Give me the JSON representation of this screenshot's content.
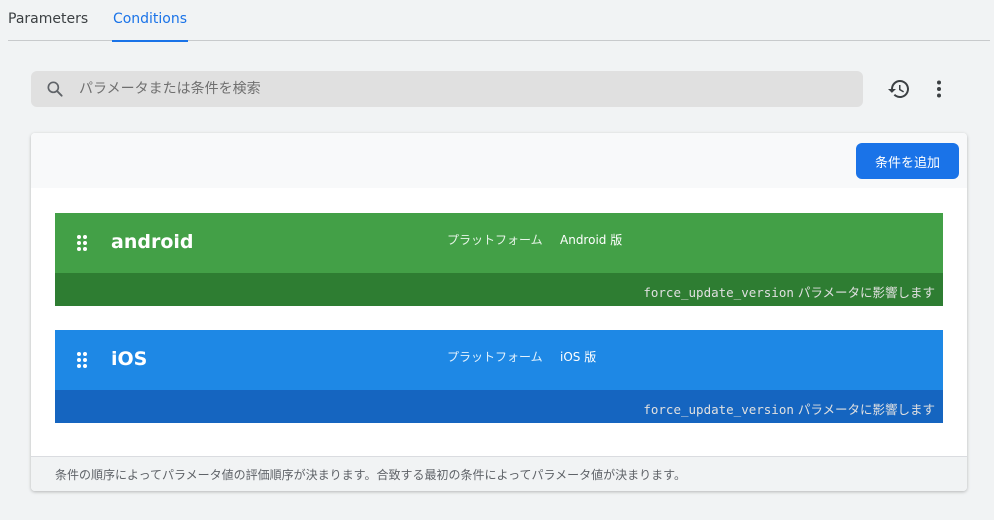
{
  "tabs": [
    {
      "label": "Parameters",
      "active": false
    },
    {
      "label": "Conditions",
      "active": true
    }
  ],
  "search": {
    "placeholder": "パラメータまたは条件を検索",
    "value": ""
  },
  "toolbar": {
    "history_icon": "history-icon",
    "more_icon": "more-vert-icon"
  },
  "conditions_card": {
    "add_button_label": "条件を追加",
    "footer_note": "条件の順序によってパラメータ値の評価順序が決まります。合致する最初の条件によってパラメータ値が決まります。",
    "conditions": [
      {
        "name": "android",
        "rule_label": "プラットフォーム",
        "rule_value": "Android 版",
        "param_name": "force_update_version",
        "affects_suffix": "パラメータに影響します",
        "header_color": "#43a047",
        "footer_color": "#2e7d32"
      },
      {
        "name": "iOS",
        "rule_label": "プラットフォーム",
        "rule_value": "iOS 版",
        "param_name": "force_update_version",
        "affects_suffix": "パラメータに影響します",
        "header_color": "#1e88e5",
        "footer_color": "#1565c0"
      }
    ]
  },
  "colors": {
    "accent": "#1a73e8",
    "page_background": "#f1f3f4"
  }
}
